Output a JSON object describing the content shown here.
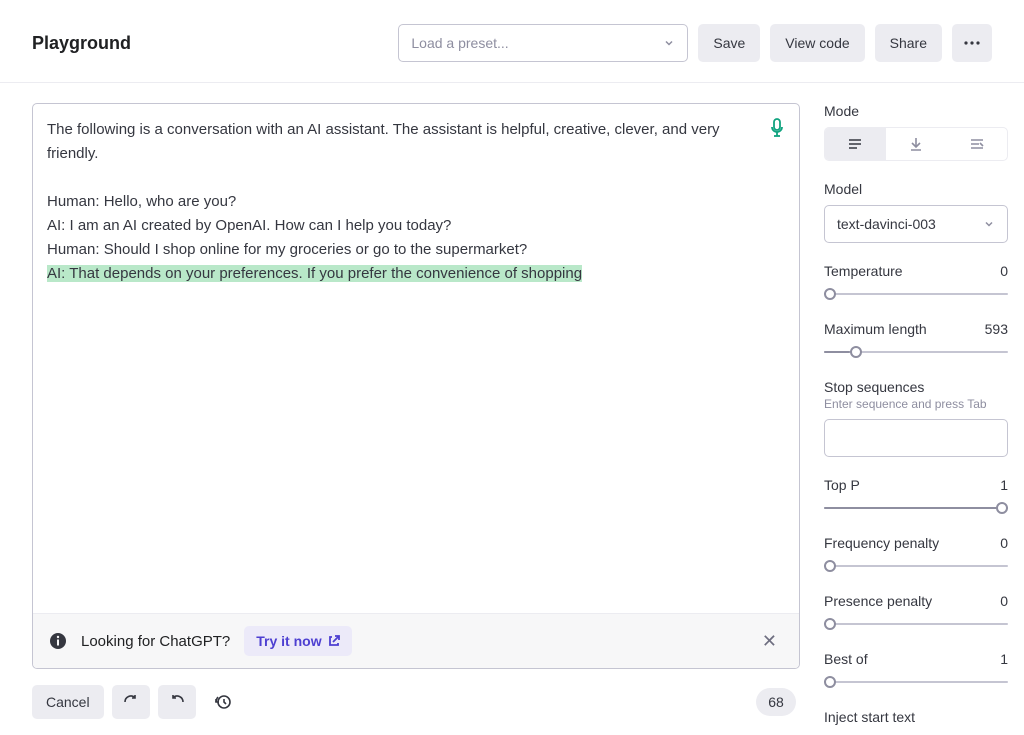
{
  "header": {
    "title": "Playground",
    "preset_placeholder": "Load a preset...",
    "save_label": "Save",
    "view_code_label": "View code",
    "share_label": "Share"
  },
  "editor": {
    "intro": "The following is a conversation with an AI assistant. The assistant is helpful, creative, clever, and very friendly.",
    "line1": "Human: Hello, who are you?",
    "line2": "AI: I am an AI created by OpenAI. How can I help you today?",
    "line3": "Human: Should I shop online for my groceries or go to the supermarket?",
    "line4_highlighted": "AI: That depends on your preferences. If you prefer the convenience of shopping"
  },
  "notice": {
    "text": "Looking for ChatGPT?",
    "try_label": "Try it now"
  },
  "footer": {
    "cancel_label": "Cancel",
    "token_count": "68"
  },
  "sidebar": {
    "mode_label": "Mode",
    "model_label": "Model",
    "model_value": "text-davinci-003",
    "temperature_label": "Temperature",
    "temperature_value": "0",
    "max_length_label": "Maximum length",
    "max_length_value": "593",
    "max_length_pct": 14,
    "stop_label": "Stop sequences",
    "stop_hint": "Enter sequence and press Tab",
    "top_p_label": "Top P",
    "top_p_value": "1",
    "freq_label": "Frequency penalty",
    "freq_value": "0",
    "presence_label": "Presence penalty",
    "presence_value": "0",
    "best_of_label": "Best of",
    "best_of_value": "1",
    "inject_label": "Inject start text"
  }
}
